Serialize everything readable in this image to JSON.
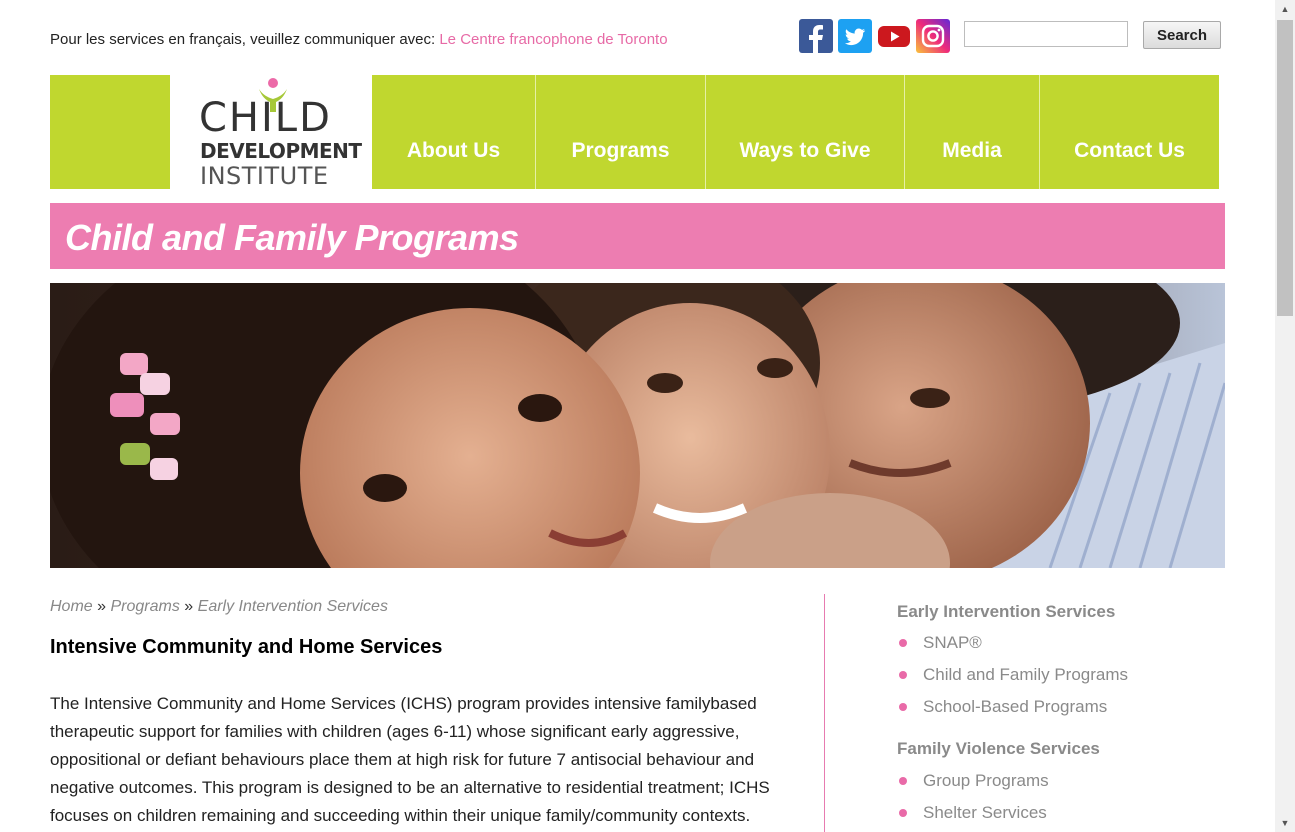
{
  "top_bar": {
    "french_text": "Pour les services en français, veuillez communiquer avec: ",
    "french_link": "Le Centre francophone de Toronto"
  },
  "social": {
    "icons": [
      "facebook-icon",
      "twitter-icon",
      "youtube-icon",
      "instagram-icon"
    ],
    "colors": {
      "facebook": "#3b5998",
      "twitter": "#1da1f2",
      "youtube": "#cc181e",
      "instagram": "#c13584"
    }
  },
  "search": {
    "placeholder": "",
    "button_label": "Search"
  },
  "logo": {
    "line1": "CHILD",
    "line2": "DEVELOPMENT",
    "line3": "INSTITUTE"
  },
  "nav": {
    "items": [
      {
        "label": "About Us"
      },
      {
        "label": "Programs"
      },
      {
        "label": "Ways to Give"
      },
      {
        "label": "Media"
      },
      {
        "label": "Contact Us"
      }
    ]
  },
  "banner": {
    "title": "Child and Family Programs"
  },
  "breadcrumb": {
    "home": "Home",
    "sep": "»",
    "programs": "Programs",
    "current": "Early Intervention Services"
  },
  "content": {
    "heading": "Intensive Community and Home Services",
    "body": "The Intensive Community and Home Services (ICHS) program provides intensive familybased therapeutic support for families with children (ages 6-11) whose significant early aggressive, oppositional or defiant behaviours place them at high risk for future 7 antisocial behaviour and negative outcomes. This program is designed to be an alternative to residential treatment; ICHS focuses on children remaining and succeeding within their unique family/community contexts."
  },
  "sidebar": {
    "section1": "Early Intervention Services",
    "section1_items": [
      "SNAP®",
      "Child and Family Programs",
      "School-Based Programs"
    ],
    "section2": "Family Violence Services",
    "section2_items": [
      "Group Programs",
      "Shelter Services"
    ]
  },
  "colors": {
    "nav_green": "#c0d72f",
    "banner_pink": "#ed7db1",
    "link_pink": "#e76aa6",
    "bullet_pink": "#e96aa8"
  }
}
